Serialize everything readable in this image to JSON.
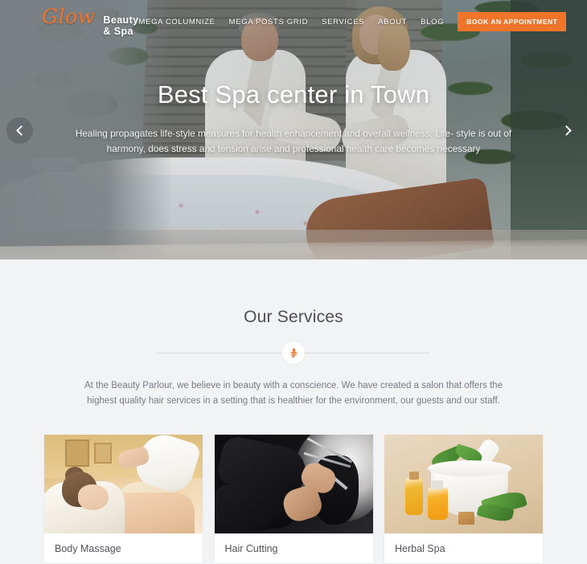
{
  "header": {
    "brand_mark": "Glow",
    "brand_sub": "Beauty & Spa",
    "nav": [
      {
        "label": "MEGA COLUMNIZE"
      },
      {
        "label": "MEGA POSTS GRID"
      },
      {
        "label": "SERVICES"
      },
      {
        "label": "ABOUT"
      },
      {
        "label": "BLOG"
      }
    ],
    "cta_label": "BOOK AN APPOINTMENT",
    "cta_color": "#f0742a",
    "brand_color": "#f0742a"
  },
  "hero": {
    "title": "Best Spa center in Town",
    "subtitle": "Healing propagates life-style measures for health enhancement and overall wellness. Life- style is out of harmony, does stress and tension arise and professional health care becomes necessary",
    "prev_arrow": "‹",
    "next_arrow": "›"
  },
  "services": {
    "title": "Our Services",
    "divider_icon": "leaf-icon",
    "divider_icon_color": "#f0742a",
    "description": "At the Beauty Parlour, we believe in beauty with a conscience. We have created a salon that offers the highest quality hair services in a setting that is healthier for the environment, our guests and our staff.",
    "cards": [
      {
        "title": "Body Massage",
        "image": "massage-photo"
      },
      {
        "title": "Hair Cutting",
        "image": "haircut-photo"
      },
      {
        "title": "Herbal Spa",
        "image": "herbal-spa-photo"
      }
    ]
  },
  "theme": {
    "page_background": "#f2f3f5",
    "accent": "#f0742a",
    "heading_color": "#4a5056",
    "body_text_color": "#767b82"
  }
}
